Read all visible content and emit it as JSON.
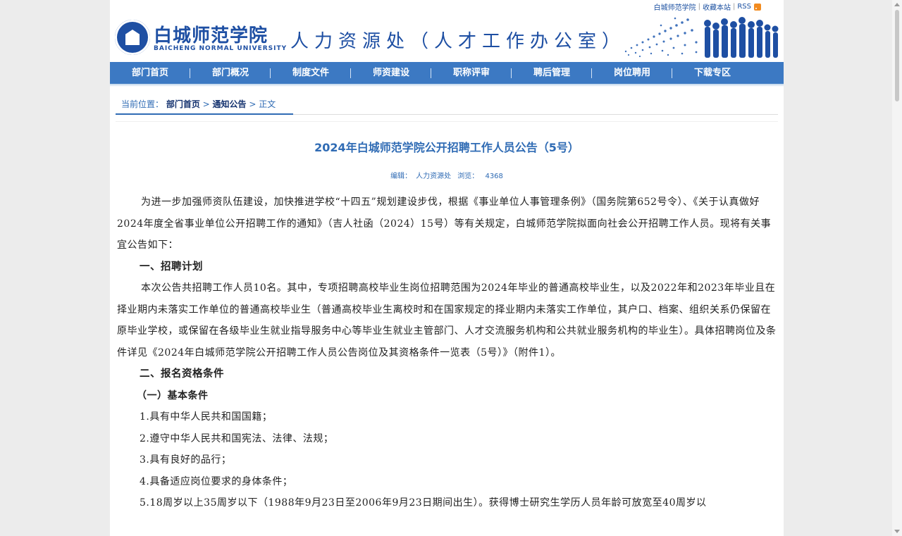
{
  "toplinks": {
    "school": "白城师范学院",
    "favorite": "收藏本站",
    "rss": "RSS"
  },
  "header": {
    "logo_cn": "白城师范学院",
    "logo_en": "BAICHENG NORMAL UNIVERSITY",
    "dept_title": "人力资源处（人才工作办公室）"
  },
  "nav": {
    "items": [
      "部门首页",
      "部门概况",
      "制度文件",
      "师资建设",
      "职称评审",
      "聘后管理",
      "岗位聘用",
      "下载专区"
    ]
  },
  "breadcrumb": {
    "label": "当前位置：",
    "home": "部门首页",
    "sep1": " > ",
    "notice": "通知公告",
    "sep2": " > ",
    "current": "正文"
  },
  "article": {
    "title": "2024年白城师范学院公开招聘工作人员公告（5号）",
    "editor_label": "编辑：",
    "editor": "人力资源处",
    "views_label": "浏览：",
    "views": "4368",
    "paragraphs": {
      "intro": "为进一步加强师资队伍建设，加快推进学校“十四五”规划建设步伐，根据《事业单位人事管理条例》（国务院第652号令）、《关于认真做好2024年度全省事业单位公开招聘工作的通知》（吉人社函（2024）15号）等有关规定，白城师范学院拟面向社会公开招聘工作人员。现将有关事宜公告如下：",
      "h1": "一、招聘计划",
      "plan": "本次公告共招聘工作人员10名。其中，专项招聘高校毕业生岗位招聘范围为2024年毕业的普通高校毕业生，以及2022年和2023年毕业且在择业期内未落实工作单位的普通高校毕业生（普通高校毕业生离校时和在国家规定的择业期内未落实工作单位，其户口、档案、组织关系仍保留在原毕业学校，或保留在各级毕业生就业指导服务中心等毕业生就业主管部门、人才交流服务机构和公共就业服务机构的毕业生）。具体招聘岗位及条件详见《2024年白城师范学院公开招聘工作人员公告岗位及其资格条件一览表（5号）》（附件1）。",
      "h2": "二、报名资格条件",
      "h3": "（一）基本条件",
      "c1": "1.具有中华人民共和国国籍；",
      "c2": "2.遵守中华人民共和国宪法、法律、法规；",
      "c3": "3.具有良好的品行；",
      "c4": "4.具备适应岗位要求的身体条件；",
      "c5": "5.18周岁以上35周岁以下（1988年9月23日至2006年9月23日期间出生）。获得博士研究生学历人员年龄可放宽至40周岁以"
    }
  }
}
